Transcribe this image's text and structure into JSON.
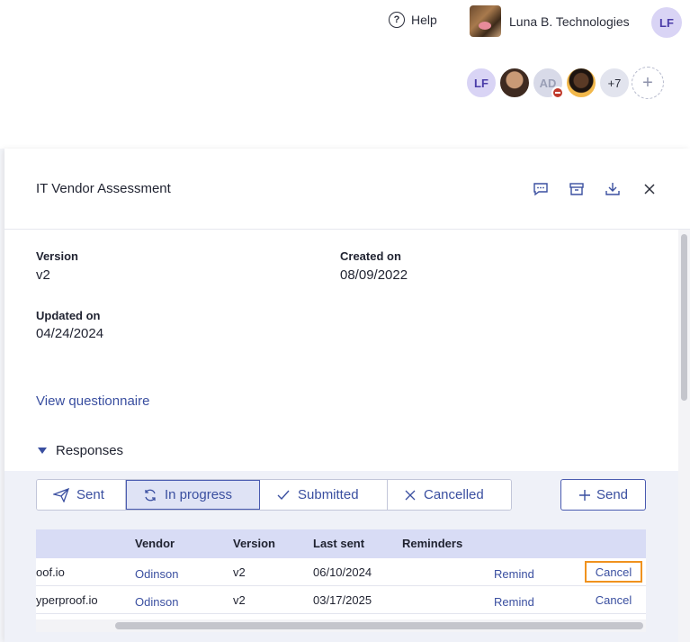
{
  "topbar": {
    "help_label": "Help",
    "help_glyph": "?",
    "org_name": "Luna B. Technologies",
    "user_initials": "LF"
  },
  "collaborators": {
    "first_initials": "LF",
    "ad_initials": "AD",
    "more_count": "+7",
    "add_glyph": "+"
  },
  "panel": {
    "title": "IT Vendor Assessment",
    "version_label": "Version",
    "version_value": "v2",
    "created_label": "Created on",
    "created_value": "08/09/2022",
    "updated_label": "Updated on",
    "updated_value": "04/24/2024",
    "view_questionnaire": "View questionnaire",
    "responses_label": "Responses"
  },
  "responses": {
    "tabs": [
      {
        "label": "Sent",
        "icon": "paper-plane-icon"
      },
      {
        "label": "In progress",
        "icon": "refresh-icon"
      },
      {
        "label": "Submitted",
        "icon": "check-icon"
      },
      {
        "label": "Cancelled",
        "icon": "x-icon"
      }
    ],
    "active_tab": "In progress",
    "send_label": "Send",
    "columns": [
      "Vendor",
      "Version",
      "Last sent",
      "Reminders"
    ],
    "rows": [
      {
        "email": "oof.io",
        "vendor": "Odinson",
        "version": "v2",
        "last_sent": "06/10/2024",
        "remind": "Remind",
        "cancel": "Cancel"
      },
      {
        "email": "yperproof.io",
        "vendor": "Odinson",
        "version": "v2",
        "last_sent": "03/17/2025",
        "remind": "Remind",
        "cancel": "Cancel"
      }
    ]
  },
  "colors": {
    "accent": "#3a4fa0",
    "focus_outline": "#f0921e",
    "table_header": "#d8dcf5"
  }
}
